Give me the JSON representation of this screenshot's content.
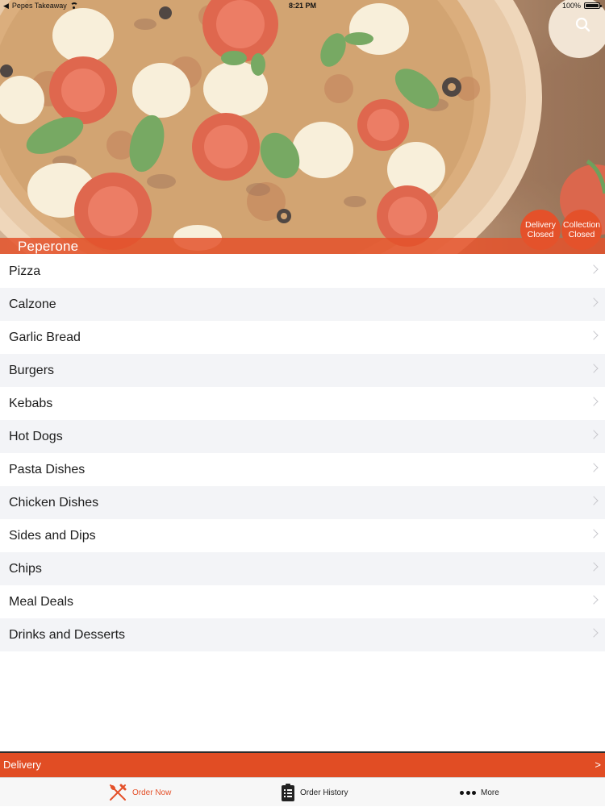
{
  "status_bar": {
    "back_app": "Pepes Takeaway",
    "time": "8:21 PM",
    "battery": "100%"
  },
  "header": {
    "restaurant_name": "Peperone",
    "search_icon": "search-icon",
    "delivery_status": {
      "line1": "Delivery",
      "line2": "Closed"
    },
    "collection_status": {
      "line1": "Collection",
      "line2": "Closed"
    }
  },
  "menu": {
    "items": [
      {
        "label": "Pizza"
      },
      {
        "label": "Calzone"
      },
      {
        "label": "Garlic Bread"
      },
      {
        "label": "Burgers"
      },
      {
        "label": "Kebabs"
      },
      {
        "label": "Hot Dogs"
      },
      {
        "label": "Pasta Dishes"
      },
      {
        "label": "Chicken Dishes"
      },
      {
        "label": "Sides and Dips"
      },
      {
        "label": "Chips"
      },
      {
        "label": "Meal Deals"
      },
      {
        "label": "Drinks and Desserts"
      }
    ]
  },
  "delivery_bar": {
    "label": "Delivery",
    "arrow": ">"
  },
  "tab_bar": {
    "items": [
      {
        "label": "Order Now",
        "icon": "fork-knife-icon",
        "active": true
      },
      {
        "label": "Order History",
        "icon": "clipboard-icon",
        "active": false
      },
      {
        "label": "More",
        "icon": "more-dots-icon",
        "active": false
      }
    ]
  },
  "colors": {
    "accent": "#e4512a",
    "delivery_bar": "#e14d24",
    "row_alt": "#f3f4f7",
    "tab_bar": "#f7f7f7"
  }
}
